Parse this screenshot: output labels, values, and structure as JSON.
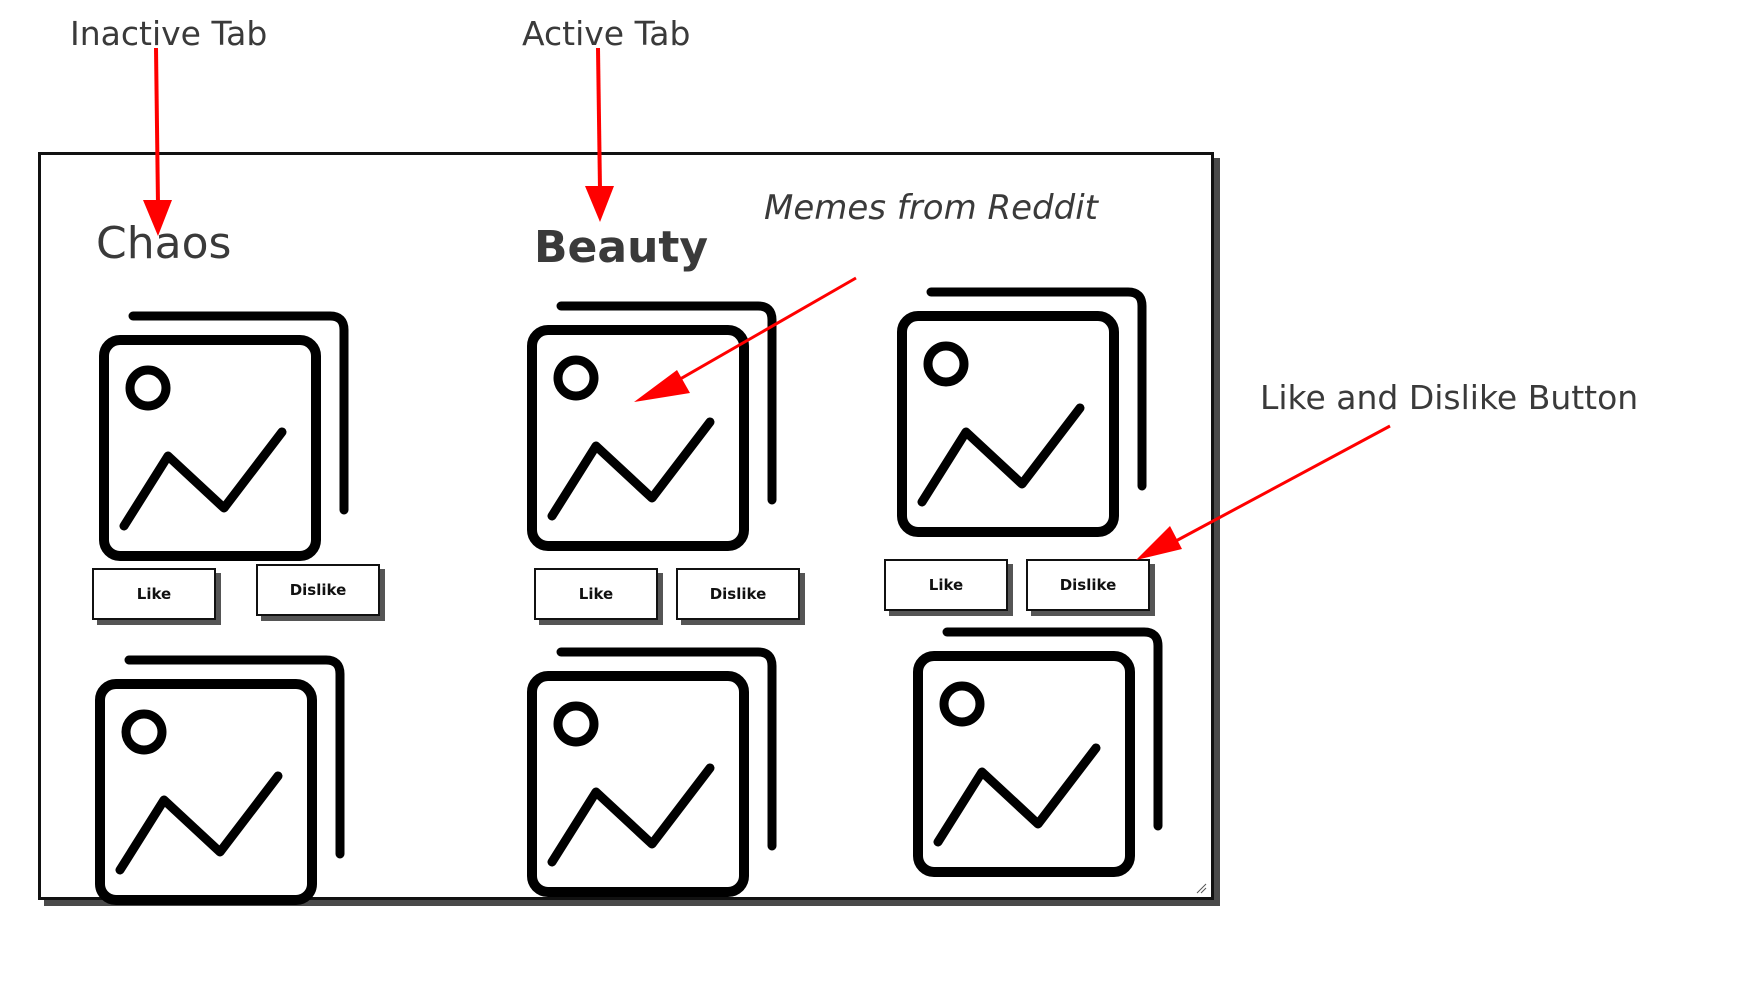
{
  "annotations": {
    "inactive_tab": "Inactive Tab",
    "active_tab": "Active Tab",
    "like_dislike": "Like and Dislike Button"
  },
  "tabs": {
    "chaos": "Chaos",
    "beauty": "Beauty"
  },
  "subtitle": "Memes from Reddit",
  "buttons": {
    "like": "Like",
    "dislike": "Dislike"
  },
  "cards": [
    {
      "icon": "image-icon"
    },
    {
      "icon": "image-icon"
    },
    {
      "icon": "image-icon"
    },
    {
      "icon": "image-icon"
    },
    {
      "icon": "image-icon"
    },
    {
      "icon": "image-icon"
    }
  ],
  "colors": {
    "arrow": "#ff0000",
    "frame": "#111111",
    "shadow": "#4a4a4a"
  }
}
